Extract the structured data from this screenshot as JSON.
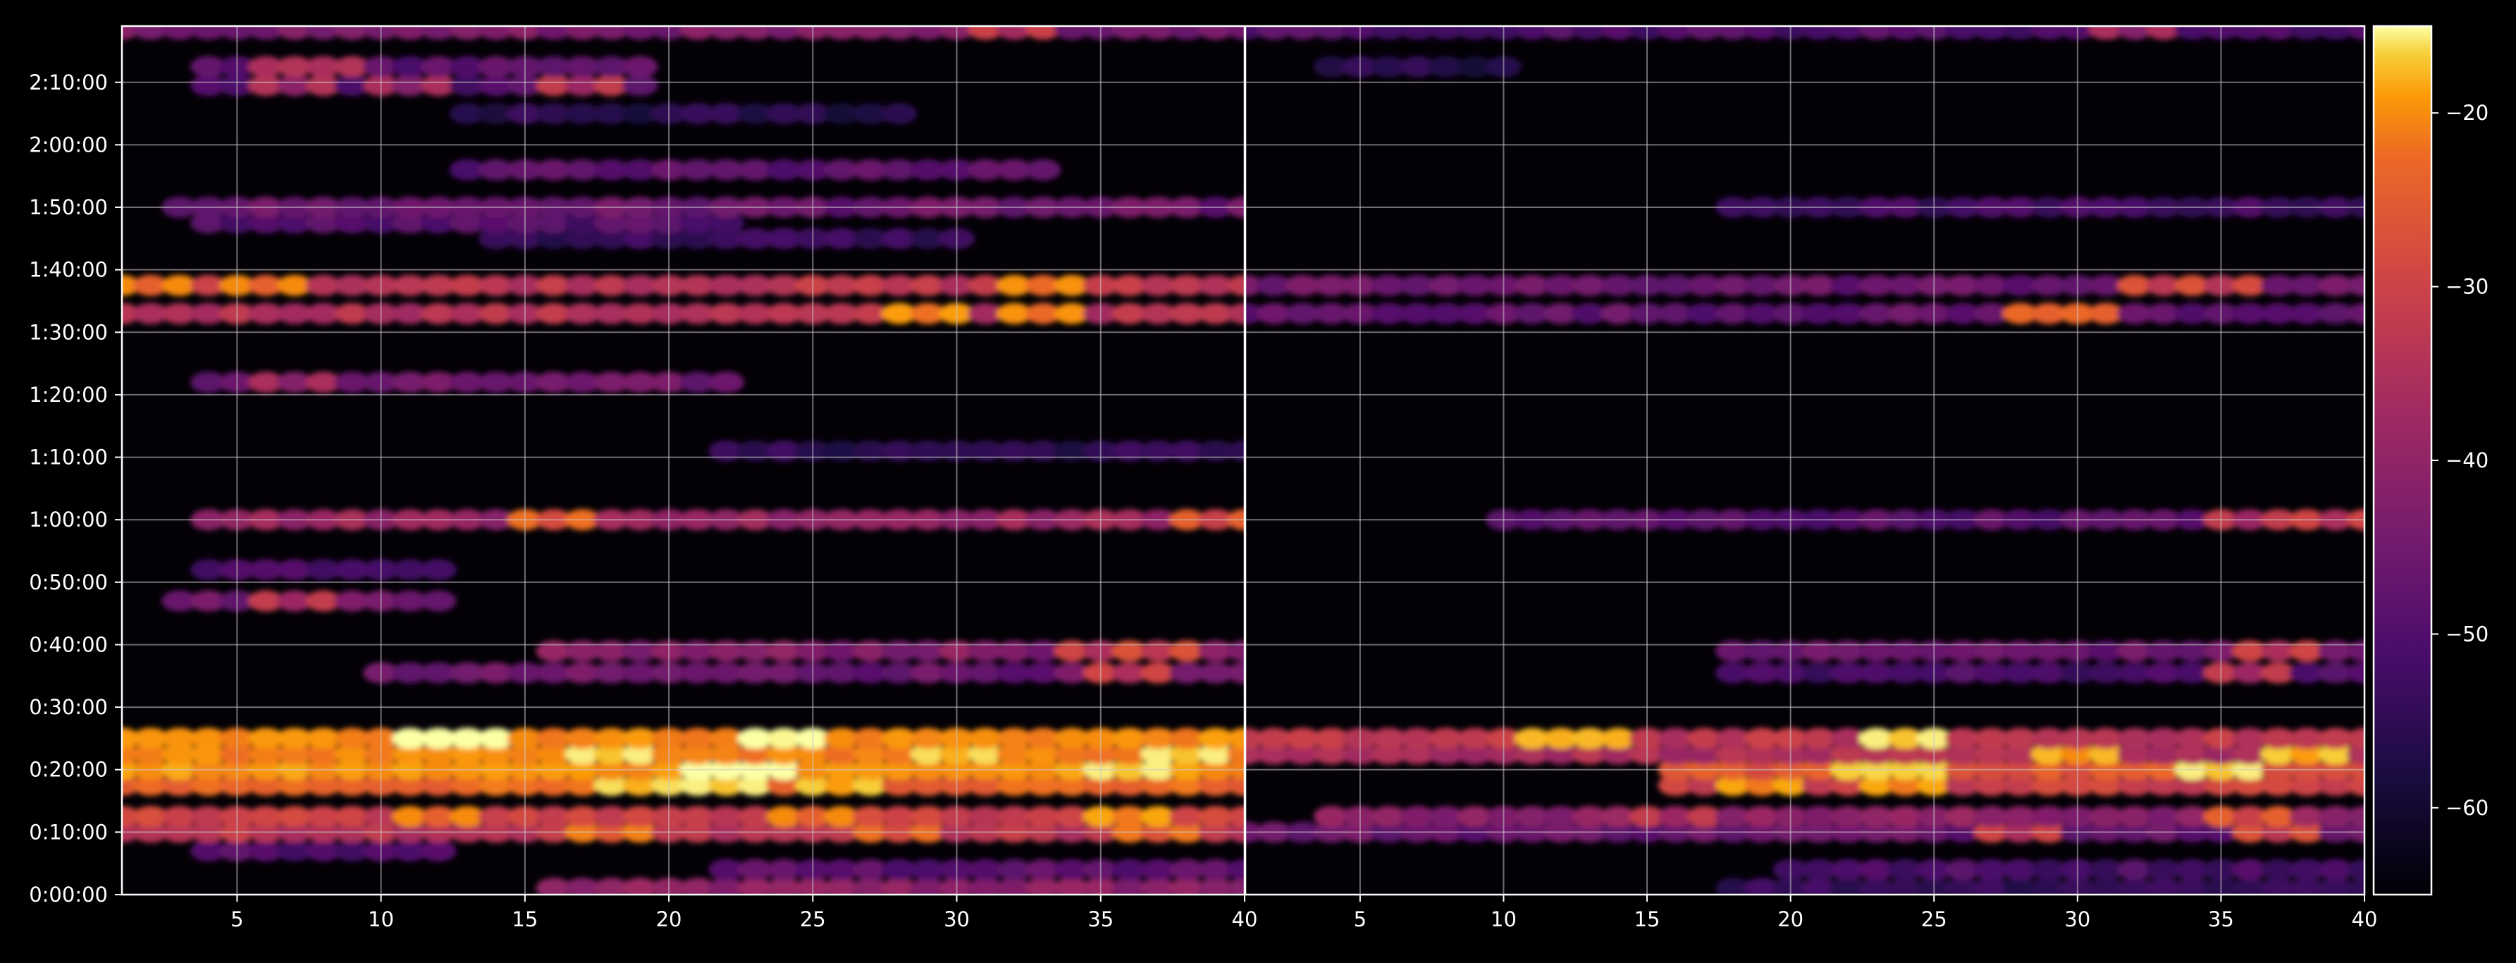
{
  "chart_data": {
    "type": "heatmap",
    "title": "",
    "colormap": "inferno",
    "background": "#000000",
    "layout": "two heatmap panels side by side sharing the time axis, one colorbar on the right",
    "grid": true,
    "x_ticks": [
      "5",
      "10",
      "15",
      "20",
      "25",
      "30",
      "35",
      "40"
    ],
    "x_tick_values": [
      5,
      10,
      15,
      20,
      25,
      30,
      35,
      40
    ],
    "y_ticks": [
      "0:00:00",
      "0:10:00",
      "0:20:00",
      "0:30:00",
      "0:40:00",
      "0:50:00",
      "1:00:00",
      "1:10:00",
      "1:20:00",
      "1:30:00",
      "1:40:00",
      "1:50:00",
      "2:00:00",
      "2:10:00"
    ],
    "y_tick_values_min": [
      0,
      10,
      20,
      30,
      40,
      50,
      60,
      70,
      80,
      90,
      100,
      110,
      120,
      130
    ],
    "colorbar": {
      "ticks": [
        "−20",
        "−30",
        "−40",
        "−50",
        "−60"
      ],
      "tick_values": [
        -20,
        -30,
        -40,
        -50,
        -60
      ],
      "range": [
        -65,
        -15
      ]
    },
    "panels": [
      {
        "name": "left",
        "xlim": [
          1,
          40
        ],
        "ylim_min": [
          0,
          139
        ],
        "bands": [
          {
            "t_min": 1.0,
            "x_range": [
              16,
              40
            ],
            "level": -46,
            "note": "base band"
          },
          {
            "t_min": 4.0,
            "x_range": [
              22,
              40
            ],
            "level": -52
          },
          {
            "t_min": 7.0,
            "x_range": [
              4,
              12
            ],
            "level": -53
          },
          {
            "t_min": 10.0,
            "x_range": [
              1,
              40
            ],
            "level": -40,
            "peaks": [
              [
                18,
                -34
              ],
              [
                28,
                -36
              ],
              [
                37,
                -35
              ]
            ]
          },
          {
            "t_min": 12.5,
            "x_range": [
              1,
              40
            ],
            "level": -38,
            "peaks": [
              [
                12,
                -33
              ],
              [
                25,
                -33
              ],
              [
                36,
                -30
              ]
            ]
          },
          {
            "t_min": 17.5,
            "x_range": [
              1,
              40
            ],
            "level": -32,
            "peaks": [
              [
                19,
                -24
              ],
              [
                22,
                -22
              ],
              [
                26,
                -26
              ]
            ]
          },
          {
            "t_min": 20.0,
            "x_range": [
              1,
              40
            ],
            "level": -27,
            "peaks": [
              [
                22,
                -19
              ],
              [
                23,
                -18
              ],
              [
                36,
                -22
              ]
            ]
          },
          {
            "t_min": 22.5,
            "x_range": [
              1,
              40
            ],
            "level": -29,
            "peaks": [
              [
                18,
                -22
              ],
              [
                30,
                -24
              ],
              [
                38,
                -22
              ]
            ]
          },
          {
            "t_min": 25.0,
            "x_range": [
              1,
              40
            ],
            "level": -28,
            "peaks": [
              [
                12,
                -15
              ],
              [
                13,
                -15
              ],
              [
                24,
                -16
              ]
            ]
          },
          {
            "t_min": 35.5,
            "x_range": [
              10,
              40
            ],
            "level": -50,
            "peaks": [
              [
                36,
                -42
              ]
            ]
          },
          {
            "t_min": 39.0,
            "x_range": [
              16,
              40
            ],
            "level": -47,
            "peaks": [
              [
                35,
                -42
              ],
              [
                37,
                -40
              ]
            ]
          },
          {
            "t_min": 47.0,
            "x_range": [
              3,
              12
            ],
            "level": -49,
            "peaks": [
              [
                7,
                -44
              ]
            ]
          },
          {
            "t_min": 52.0,
            "x_range": [
              4,
              12
            ],
            "level": -53,
            "peaks": [
              [
                17,
                -47
              ]
            ]
          },
          {
            "t_min": 60.0,
            "x_range": [
              4,
              40
            ],
            "level": -44,
            "peaks": [
              [
                16,
                -36
              ],
              [
                39,
                -38
              ]
            ]
          },
          {
            "t_min": 71.0,
            "x_range": [
              22,
              40
            ],
            "level": -57
          },
          {
            "t_min": 82.0,
            "x_range": [
              4,
              22
            ],
            "level": -50,
            "peaks": [
              [
                7,
                -47
              ]
            ]
          },
          {
            "t_min": 93.0,
            "x_range": [
              1,
              40
            ],
            "level": -41,
            "peaks": [
              [
                29,
                -31
              ],
              [
                33,
                -32
              ]
            ]
          },
          {
            "t_min": 97.5,
            "x_range": [
              1,
              40
            ],
            "level": -40,
            "peaks": [
              [
                2,
                -33
              ],
              [
                6,
                -33
              ],
              [
                33,
                -32
              ]
            ]
          },
          {
            "t_min": 105.0,
            "x_range": [
              14,
              30
            ],
            "level": -56
          },
          {
            "t_min": 107.5,
            "x_range": [
              4,
              22
            ],
            "level": -53
          },
          {
            "t_min": 110.0,
            "x_range": [
              3,
              40
            ],
            "level": -50
          },
          {
            "t_min": 116.0,
            "x_range": [
              13,
              33
            ],
            "level": -52
          },
          {
            "t_min": 125.0,
            "x_range": [
              13,
              28
            ],
            "level": -58
          },
          {
            "t_min": 129.5,
            "x_range": [
              4,
              19
            ],
            "level": -53,
            "peaks": [
              [
                7,
                -46
              ],
              [
                11,
                -47
              ],
              [
                17,
                -44
              ]
            ]
          },
          {
            "t_min": 132.5,
            "x_range": [
              4,
              19
            ],
            "level": -52,
            "peaks": [
              [
                7,
                -47
              ],
              [
                8,
                -46
              ]
            ]
          },
          {
            "t_min": 138.5,
            "x_range": [
              1,
              40
            ],
            "level": -48,
            "peaks": [
              [
                32,
                -43
              ]
            ]
          }
        ]
      },
      {
        "name": "right",
        "xlim": [
          1,
          40
        ],
        "ylim_min": [
          0,
          139
        ],
        "bands": [
          {
            "t_min": 1.0,
            "x_range": [
              18,
              40
            ],
            "level": -56
          },
          {
            "t_min": 4.0,
            "x_range": [
              20,
              40
            ],
            "level": -54
          },
          {
            "t_min": 10.0,
            "x_range": [
              1,
              40
            ],
            "level": -50,
            "peaks": [
              [
                28,
                -42
              ],
              [
                37,
                -40
              ]
            ]
          },
          {
            "t_min": 12.5,
            "x_range": [
              4,
              40
            ],
            "level": -46,
            "peaks": [
              [
                16,
                -44
              ],
              [
                36,
                -38
              ]
            ]
          },
          {
            "t_min": 17.5,
            "x_range": [
              16,
              40
            ],
            "level": -38,
            "peaks": [
              [
                19,
                -30
              ],
              [
                24,
                -30
              ]
            ]
          },
          {
            "t_min": 20.0,
            "x_range": [
              16,
              40
            ],
            "level": -34,
            "peaks": [
              [
                23,
                -26
              ],
              [
                24,
                -25
              ],
              [
                35,
                -22
              ]
            ]
          },
          {
            "t_min": 22.5,
            "x_range": [
              1,
              40
            ],
            "level": -42,
            "peaks": [
              [
                30,
                -28
              ],
              [
                38,
                -26
              ]
            ]
          },
          {
            "t_min": 25.0,
            "x_range": [
              1,
              40
            ],
            "level": -40,
            "peaks": [
              [
                12,
                -28
              ],
              [
                13,
                -29
              ],
              [
                24,
                -22
              ]
            ]
          },
          {
            "t_min": 35.5,
            "x_range": [
              18,
              40
            ],
            "level": -54,
            "peaks": [
              [
                36,
                -44
              ]
            ]
          },
          {
            "t_min": 39.0,
            "x_range": [
              18,
              40
            ],
            "level": -50,
            "peaks": [
              [
                37,
                -42
              ]
            ]
          },
          {
            "t_min": 60.0,
            "x_range": [
              10,
              40
            ],
            "level": -52,
            "peaks": [
              [
                36,
                -44
              ],
              [
                39,
                -42
              ]
            ]
          },
          {
            "t_min": 93.0,
            "x_range": [
              1,
              40
            ],
            "level": -51,
            "peaks": [
              [
                29,
                -37
              ],
              [
                30,
                -38
              ]
            ]
          },
          {
            "t_min": 97.5,
            "x_range": [
              1,
              40
            ],
            "level": -50,
            "peaks": [
              [
                33,
                -40
              ],
              [
                35,
                -41
              ]
            ]
          },
          {
            "t_min": 110.0,
            "x_range": [
              18,
              40
            ],
            "level": -55
          },
          {
            "t_min": 132.5,
            "x_range": [
              4,
              10
            ],
            "level": -58
          },
          {
            "t_min": 138.5,
            "x_range": [
              1,
              40
            ],
            "level": -53,
            "peaks": [
              [
                32,
                -47
              ]
            ]
          }
        ]
      }
    ]
  }
}
